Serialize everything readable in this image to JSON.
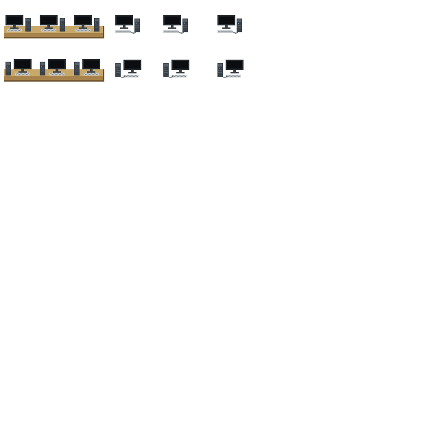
{
  "sprite_sheet": {
    "background": "#ffffff",
    "palette": {
      "monitor_frame": "#262b30",
      "monitor_screen": "#0b0d10",
      "monitor_stand": "#3b4248",
      "keyboard": "#c9ced2",
      "keyboard_keys": "#7e868d",
      "tower_body": "#3a4249",
      "tower_panel": "#56606a",
      "tower_light": "#8fb5c9",
      "cable": "#4a5056",
      "desk_top": "#c8a86a",
      "desk_front": "#a7834b",
      "desk_edge": "#6e5330"
    },
    "rows": [
      {
        "facing": "front",
        "desk_group": {
          "workstations": 3,
          "icon": "desk-with-three-computers-icon"
        },
        "singles": [
          {
            "icon": "computer-workstation-icon",
            "tower_side": "right"
          },
          {
            "icon": "computer-workstation-icon",
            "tower_side": "right"
          },
          {
            "icon": "computer-workstation-icon",
            "tower_side": "right"
          }
        ]
      },
      {
        "facing": "front",
        "desk_group": {
          "workstations": 3,
          "icon": "desk-with-three-computers-icon"
        },
        "singles": [
          {
            "icon": "computer-workstation-icon",
            "tower_side": "left"
          },
          {
            "icon": "computer-workstation-icon",
            "tower_side": "left"
          },
          {
            "icon": "computer-workstation-icon",
            "tower_side": "left"
          }
        ]
      }
    ]
  }
}
